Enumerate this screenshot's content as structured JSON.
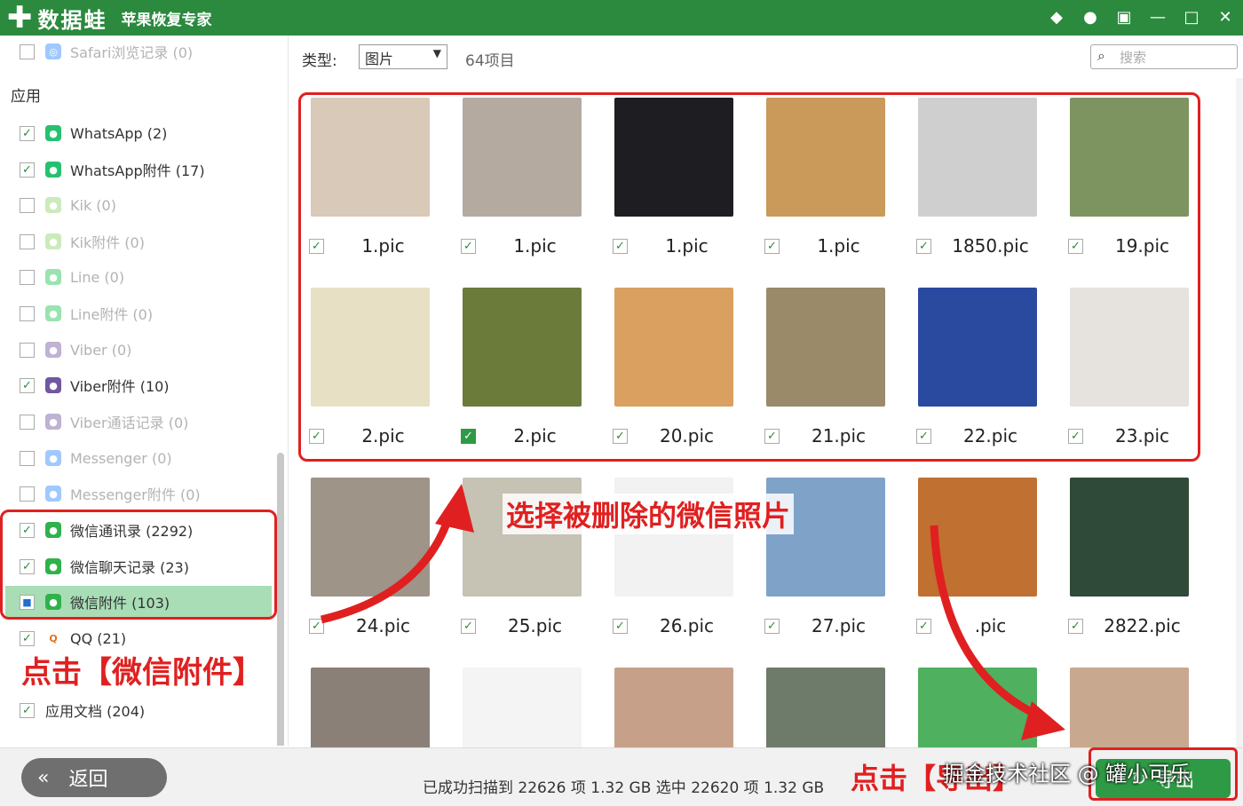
{
  "titlebar": {
    "brand": "数据蛙",
    "subtitle": "苹果恢复专家",
    "icons": [
      "diamond-icon",
      "chat-icon",
      "monitor-icon",
      "minimize-icon",
      "maximize-icon",
      "close-icon"
    ]
  },
  "sidebar": {
    "top_item": "Safari浏览记录 (0)",
    "section_title": "应用",
    "items": [
      {
        "label": "WhatsApp (2)",
        "checked": true,
        "icon": "whatsapp-icon",
        "color": "#25c26e"
      },
      {
        "label": "WhatsApp附件 (17)",
        "checked": true,
        "icon": "whatsapp-icon",
        "color": "#25c26e"
      },
      {
        "label": "Kik (0)",
        "checked": false,
        "icon": "kik-icon",
        "color": "#8fd16a"
      },
      {
        "label": "Kik附件 (0)",
        "checked": false,
        "icon": "kik-icon",
        "color": "#8fd16a"
      },
      {
        "label": "Line (0)",
        "checked": false,
        "icon": "line-icon",
        "color": "#20c34f"
      },
      {
        "label": "Line附件 (0)",
        "checked": false,
        "icon": "line-icon",
        "color": "#20c34f"
      },
      {
        "label": "Viber (0)",
        "checked": false,
        "icon": "viber-icon",
        "color": "#7256a0"
      },
      {
        "label": "Viber附件 (10)",
        "checked": true,
        "icon": "viber-icon",
        "color": "#7256a0"
      },
      {
        "label": "Viber通话记录 (0)",
        "checked": false,
        "icon": "viber-icon",
        "color": "#7256a0"
      },
      {
        "label": "Messenger (0)",
        "checked": false,
        "icon": "messenger-icon",
        "color": "#2d88ff"
      },
      {
        "label": "Messenger附件 (0)",
        "checked": false,
        "icon": "messenger-icon",
        "color": "#2d88ff"
      },
      {
        "label": "微信通讯录 (2292)",
        "checked": true,
        "icon": "wechat-icon",
        "color": "#2fb24c"
      },
      {
        "label": "微信聊天记录 (23)",
        "checked": true,
        "icon": "wechat-icon",
        "color": "#2fb24c"
      },
      {
        "label": "微信附件 (103)",
        "checked": "partial",
        "icon": "wechat-icon",
        "color": "#2fb24c"
      },
      {
        "label": "QQ (21)",
        "checked": true,
        "icon": "qq-icon",
        "color": "#ffffff"
      },
      {
        "label": "应用文档 (204)",
        "checked": true,
        "icon": "",
        "color": ""
      }
    ]
  },
  "toolbar": {
    "type_label": "类型:",
    "type_value": "图片",
    "count": "64项目",
    "search_placeholder": "搜索"
  },
  "grid": [
    {
      "name": "1.pic",
      "checked": true,
      "color": "#d9c9b8"
    },
    {
      "name": "1.pic",
      "checked": true,
      "color": "#b5aaa0"
    },
    {
      "name": "1.pic",
      "checked": true,
      "color": "#1e1e22"
    },
    {
      "name": "1.pic",
      "checked": true,
      "color": "#c99a5a"
    },
    {
      "name": "1850.pic",
      "checked": true,
      "color": "#cfcfcf"
    },
    {
      "name": "19.pic",
      "checked": true,
      "color": "#7d9460"
    },
    {
      "name": "2.pic",
      "checked": true,
      "color": "#e8e0c4"
    },
    {
      "name": "2.pic",
      "checked": "green",
      "color": "#6a7b3a"
    },
    {
      "name": "20.pic",
      "checked": true,
      "color": "#d9a060"
    },
    {
      "name": "21.pic",
      "checked": true,
      "color": "#9a8a6a"
    },
    {
      "name": "22.pic",
      "checked": true,
      "color": "#2a4aa0"
    },
    {
      "name": "23.pic",
      "checked": true,
      "color": "#e6e2de"
    },
    {
      "name": "24.pic",
      "checked": true,
      "color": "#9e9488"
    },
    {
      "name": "25.pic",
      "checked": true,
      "color": "#c6c2b4"
    },
    {
      "name": "26.pic",
      "checked": true,
      "color": "#f2f2f2"
    },
    {
      "name": "27.pic",
      "checked": true,
      "color": "#7fa2c8"
    },
    {
      "name": ".pic",
      "checked": true,
      "color": "#c07030"
    },
    {
      "name": "2822.pic",
      "checked": true,
      "color": "#2f4a38"
    },
    {
      "name": "",
      "checked": false,
      "color": "#8a8078"
    },
    {
      "name": "",
      "checked": false,
      "color": "#f4f4f4"
    },
    {
      "name": "",
      "checked": false,
      "color": "#c7a08a"
    },
    {
      "name": "",
      "checked": false,
      "color": "#6e7a6a"
    },
    {
      "name": "",
      "checked": false,
      "color": "#4fb060"
    },
    {
      "name": "",
      "checked": false,
      "color": "#c9a890"
    }
  ],
  "footer": {
    "back_label": "返回",
    "status": "已成功扫描到 22626 项 1.32 GB   选中 22620 项 1.32 GB",
    "export_label": "导出"
  },
  "annotations": {
    "select_text": "选择被删除的微信照片",
    "click_wechat": "点击【微信附件】",
    "click_export": "点击【导出】",
    "watermark": "掘金技术社区 @ 罐小可乐"
  }
}
